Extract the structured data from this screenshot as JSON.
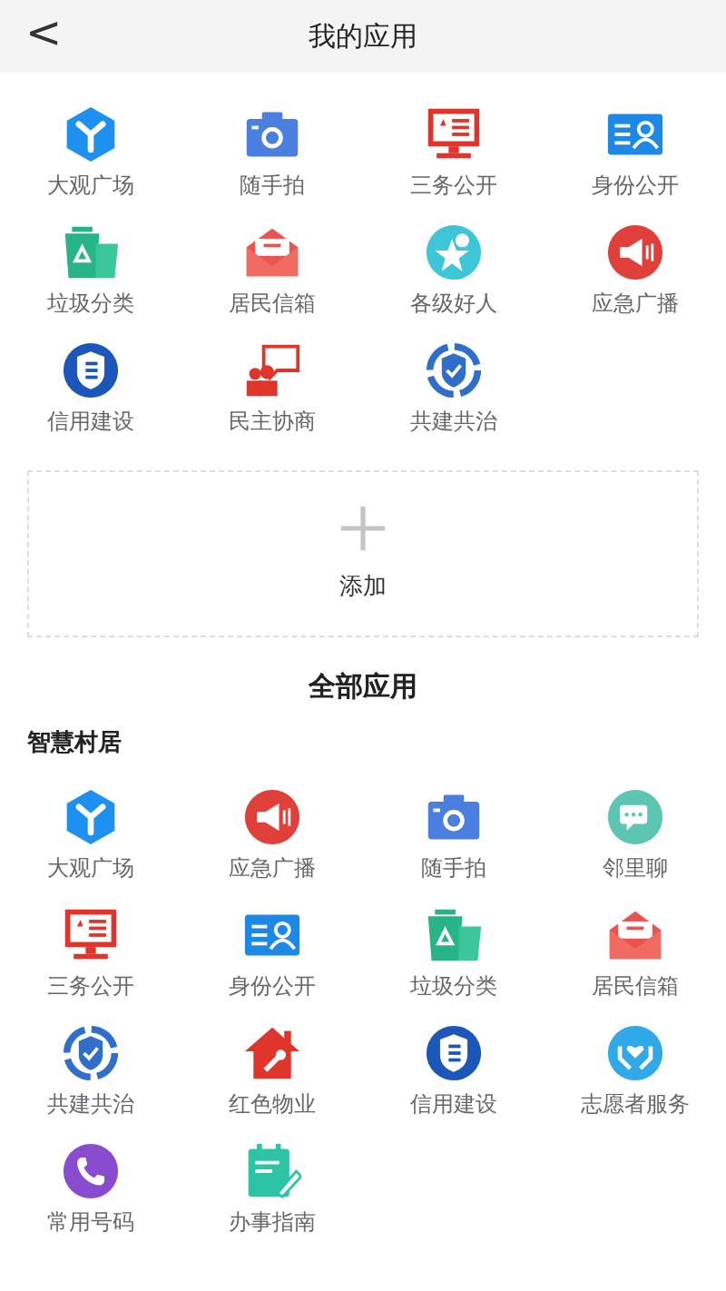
{
  "header": {
    "back": "<",
    "title": "我的应用"
  },
  "my_apps": [
    {
      "label": "大观广场",
      "kind": "cube"
    },
    {
      "label": "随手拍",
      "kind": "camera"
    },
    {
      "label": "三务公开",
      "kind": "monitor"
    },
    {
      "label": "身份公开",
      "kind": "idcard"
    },
    {
      "label": "垃圾分类",
      "kind": "bins"
    },
    {
      "label": "居民信箱",
      "kind": "mail"
    },
    {
      "label": "各级好人",
      "kind": "star"
    },
    {
      "label": "应急广播",
      "kind": "megaphone"
    },
    {
      "label": "信用建设",
      "kind": "shield"
    },
    {
      "label": "民主协商",
      "kind": "talk"
    },
    {
      "label": "共建共治",
      "kind": "ringshield"
    }
  ],
  "add": {
    "label": "添加"
  },
  "all_title": "全部应用",
  "sections": [
    {
      "title": "智慧村居",
      "apps": [
        {
          "label": "大观广场",
          "kind": "cube"
        },
        {
          "label": "应急广播",
          "kind": "megaphone"
        },
        {
          "label": "随手拍",
          "kind": "camera"
        },
        {
          "label": "邻里聊",
          "kind": "bubble"
        },
        {
          "label": "三务公开",
          "kind": "monitor"
        },
        {
          "label": "身份公开",
          "kind": "idcard"
        },
        {
          "label": "垃圾分类",
          "kind": "bins"
        },
        {
          "label": "居民信箱",
          "kind": "mail"
        },
        {
          "label": "共建共治",
          "kind": "ringshield"
        },
        {
          "label": "红色物业",
          "kind": "house"
        },
        {
          "label": "信用建设",
          "kind": "shield"
        },
        {
          "label": "志愿者服务",
          "kind": "hands"
        },
        {
          "label": "常用号码",
          "kind": "phone"
        },
        {
          "label": "办事指南",
          "kind": "notepad"
        }
      ]
    }
  ]
}
